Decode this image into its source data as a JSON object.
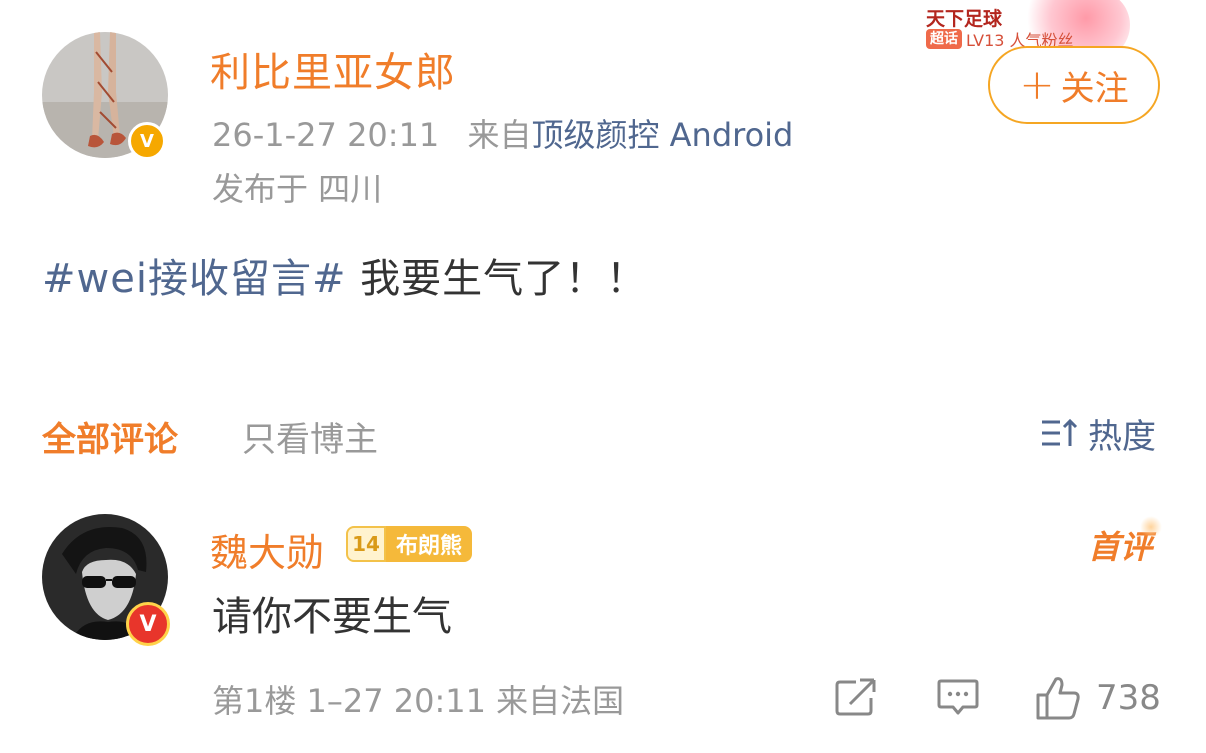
{
  "post": {
    "author_name": "利比里亚女郎",
    "timestamp": "26-1-27 20:11",
    "source_prefix": "来自",
    "source_name": "顶级颜控 Android",
    "location": "发布于 四川",
    "topic": "#wei接收留言#",
    "text": " 我要生气了！！",
    "verified_badge": "V",
    "follow_button": {
      "plus": "+",
      "label": "关注"
    },
    "supertopic": {
      "title": "天下足球",
      "tag": "超话",
      "level": "LV13 人气粉丝"
    }
  },
  "comments_tabs": {
    "all": "全部评论",
    "author_only": "只看博主",
    "sort_label": "热度"
  },
  "comment": {
    "author_name": "魏大勋",
    "fan_level": "14",
    "fan_badge_name": "布朗熊",
    "first_comment_label": "首评",
    "text": "请你不要生气",
    "meta": "第1楼 1–27 20:11 来自法国",
    "verified_badge": "V",
    "like_count": "738"
  },
  "icons": {
    "share": "share-icon",
    "reply": "comment-icon",
    "like": "thumbs-up-icon",
    "sort": "sort-icon"
  },
  "colors": {
    "accent": "#f07d2a",
    "link": "#50678f",
    "muted": "#999999",
    "text": "#333333",
    "badge_gold": "#f6a800"
  }
}
